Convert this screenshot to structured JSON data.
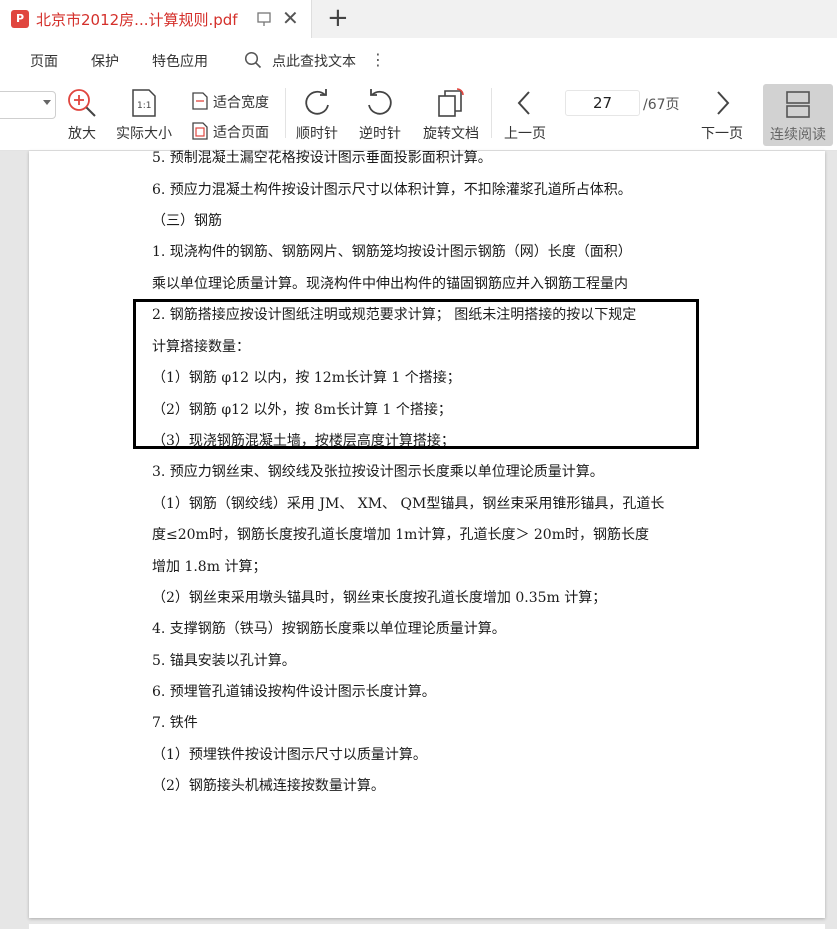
{
  "tab": {
    "title": "北京市2012房...计算规则.pdf",
    "new_tab": "+"
  },
  "menu": {
    "items": [
      "页面",
      "保护",
      "特色应用"
    ],
    "search_label": "点此查找文本"
  },
  "toolbar": {
    "zoom_in": "放大",
    "actual_size": "实际大小",
    "fit_width": "适合宽度",
    "fit_page": "适合页面",
    "rotate_cw": "顺时针",
    "rotate_ccw": "逆时针",
    "rotate_doc": "旋转文档",
    "prev_page": "上一页",
    "next_page": "下一页",
    "page_current": "27",
    "page_total": "/67页",
    "continuous": "连续阅读"
  },
  "document": {
    "lines": [
      "5.  预制混凝土漏空花格按设计图示垂面投影面积计算。",
      "6.  预应力混凝土构件按设计图示尺寸以体积计算，不扣除灌浆孔道所占体积。",
      "（三）钢筋",
      "1.  现浇构件的钢筋、钢筋网片、钢筋笼均按设计图示钢筋（网）长度（面积）",
      "乘以单位理论质量计算。现浇构件中伸出构件的锚固钢筋应并入钢筋工程量内",
      "2.  钢筋搭接应按设计图纸注明或规范要求计算；      图纸未注明搭接的按以下规定",
      "计算搭接数量：",
      "（1）钢筋   φ12 以内，按   12m长计算  1 个搭接；",
      "（2）钢筋   φ12 以外，按   8m长计算  1 个搭接；",
      "（3）现浇钢筋混凝土墙，按楼层高度计算搭接；",
      "3.  预应力钢丝束、钢绞线及张拉按设计图示长度乘以单位理论质量计算。",
      "（1）钢筋（钢绞线）采用    JM、 XM、 QM型锚具，钢丝束采用锥形锚具，孔道长",
      "度≤20m时，钢筋长度按孔道长度增加     1m计算，孔道长度＞  20m时，钢筋长度",
      "增加  1.8m 计算；",
      "（2）钢丝束采用墩头锚具时，钢丝束长度按孔道长度增加       0.35m 计算；",
      "4.  支撑钢筋（铁马）按钢筋长度乘以单位理论质量计算。",
      "5.  锚具安装以孔计算。",
      "6.  预埋管孔道铺设按构件设计图示长度计算。",
      "7.  铁件",
      "（1）预埋铁件按设计图示尺寸以质量计算。",
      "（2）钢筋接头机械连接按数量计算。"
    ]
  }
}
